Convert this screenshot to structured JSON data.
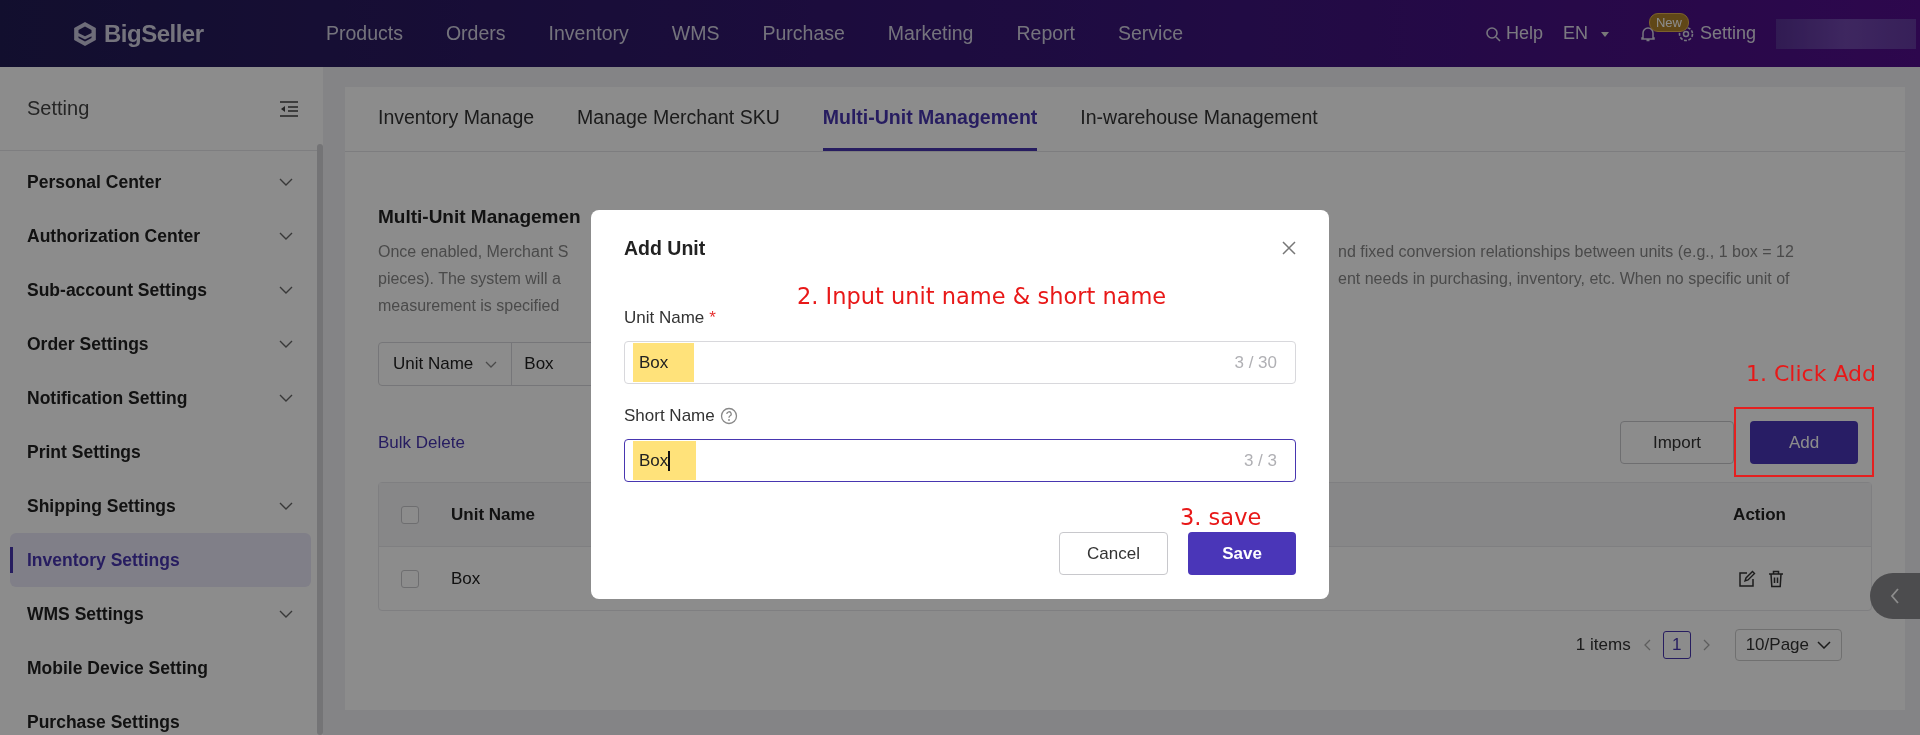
{
  "top_nav": {
    "logo": "BigSeller",
    "menu": [
      {
        "label": "Products"
      },
      {
        "label": "Orders"
      },
      {
        "label": "Inventory"
      },
      {
        "label": "WMS"
      },
      {
        "label": "Purchase"
      },
      {
        "label": "Marketing"
      },
      {
        "label": "Report"
      },
      {
        "label": "Service"
      }
    ],
    "help": "Help",
    "language": "EN",
    "badge": "New",
    "setting": "Setting"
  },
  "sidebar": {
    "title": "Setting",
    "items": [
      {
        "label": "Personal Center",
        "expandable": true,
        "selected": false
      },
      {
        "label": "Authorization Center",
        "expandable": true,
        "selected": false
      },
      {
        "label": "Sub-account Settings",
        "expandable": true,
        "selected": false
      },
      {
        "label": "Order Settings",
        "expandable": true,
        "selected": false
      },
      {
        "label": "Notification Setting",
        "expandable": true,
        "selected": false
      },
      {
        "label": "Print Settings",
        "expandable": false,
        "selected": false
      },
      {
        "label": "Shipping Settings",
        "expandable": true,
        "selected": false
      },
      {
        "label": "Inventory Settings",
        "expandable": false,
        "selected": true
      },
      {
        "label": "WMS Settings",
        "expandable": true,
        "selected": false
      },
      {
        "label": "Mobile Device Setting",
        "expandable": false,
        "selected": false
      },
      {
        "label": "Purchase Settings",
        "expandable": false,
        "selected": false
      }
    ]
  },
  "tabs": [
    {
      "label": "Inventory Manage",
      "selected": false
    },
    {
      "label": "Manage Merchant SKU",
      "selected": false
    },
    {
      "label": "Multi-Unit Management",
      "selected": true
    },
    {
      "label": "In-warehouse Management",
      "selected": false
    }
  ],
  "section": {
    "title": "Multi-Unit Managemen",
    "description_lines": [
      {
        "left": "Once enabled, Merchant S",
        "right": "nd fixed conversion relationships between units (e.g., 1 box = 12"
      },
      {
        "left": "pieces). The system will a",
        "right": "ent needs in purchasing, inventory, etc. When no specific unit of"
      },
      {
        "left": "measurement is specified"
      }
    ]
  },
  "filter": {
    "field": "Unit Name",
    "value": "Box"
  },
  "actions": {
    "bulk_delete": "Bulk Delete",
    "import": "Import",
    "add": "Add"
  },
  "table": {
    "header": {
      "checked": false,
      "unit_name": "Unit Name",
      "action": "Action"
    },
    "rows": [
      {
        "unit_name": "Box",
        "checked": false
      }
    ]
  },
  "pagination": {
    "total": "1 items",
    "pages": [
      {
        "label": "1",
        "selected": true
      }
    ],
    "page_size": "10/Page"
  },
  "dialog": {
    "title": "Add Unit",
    "fields": [
      {
        "label": "Unit Name",
        "required_mark": "*",
        "value": "Box",
        "counter": "3 / 30",
        "focused": false
      },
      {
        "label": "Short Name",
        "help": true,
        "value": "Box",
        "counter": "3 / 3",
        "focused": true
      }
    ],
    "cancel": "Cancel",
    "save": "Save"
  },
  "annotations": [
    {
      "text": "1. Click Add"
    },
    {
      "text": "2. Input unit name & short name"
    },
    {
      "text": "3. save"
    }
  ]
}
